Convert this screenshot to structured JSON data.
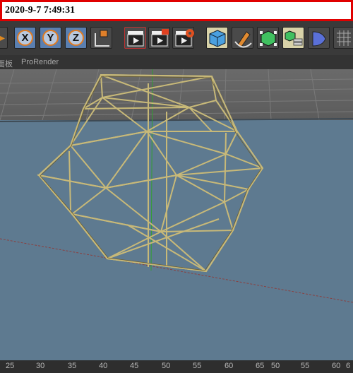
{
  "timestamp": "2020-9-7 7:49:31",
  "toolbar": {
    "axis_x": "X",
    "axis_y": "Y",
    "axis_z": "Z"
  },
  "menubar": {
    "left_partial": "面板",
    "prorender": "ProRender"
  },
  "ruler": {
    "ticks": [
      "25",
      "30",
      "35",
      "40",
      "45",
      "50",
      "55",
      "60",
      "65",
      "50",
      "55",
      "60",
      "6"
    ]
  },
  "colors": {
    "timestamp_border": "#e00000",
    "floor": "#5e7a90",
    "wire": "#c8b978",
    "axis_highlight": "#e07a20"
  }
}
